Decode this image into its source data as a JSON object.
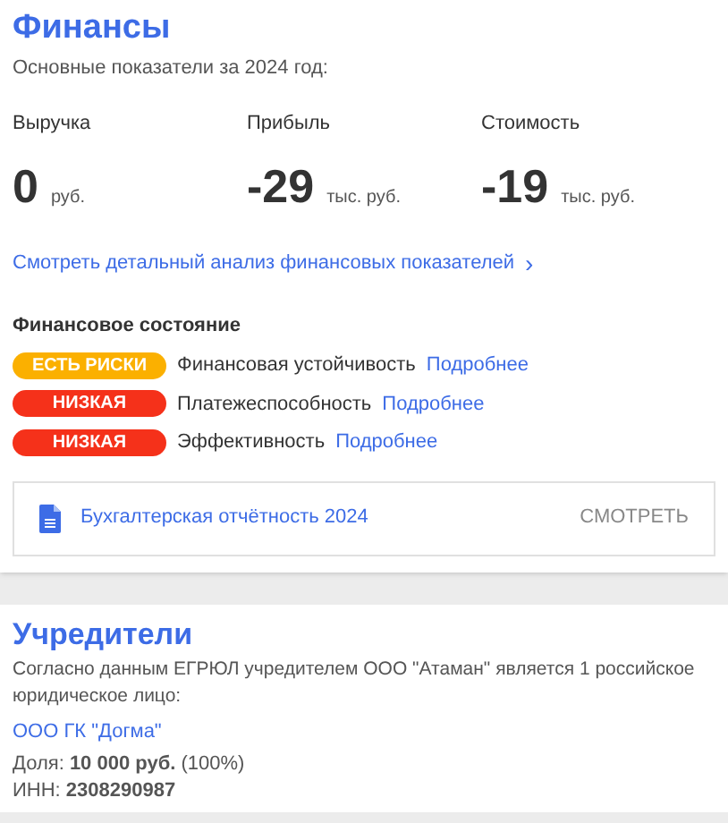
{
  "finance": {
    "title": "Финансы",
    "subtitle": "Основные показатели за 2024 год:",
    "metrics": [
      {
        "label": "Выручка",
        "value": "0",
        "unit": "руб."
      },
      {
        "label": "Прибыль",
        "value": "-29",
        "unit": "тыс. руб."
      },
      {
        "label": "Стоимость",
        "value": "-19",
        "unit": "тыс. руб."
      }
    ],
    "analysis_link": "Смотреть детальный анализ финансовых показателей",
    "analysis_chevron": "›",
    "state_title": "Финансовое состояние",
    "states": [
      {
        "badge": "ЕСТЬ РИСКИ",
        "color": "#fbb000",
        "label": "Финансовая устойчивость",
        "link": "Подробнее"
      },
      {
        "badge": "НИЗКАЯ",
        "color": "#f5311a",
        "label": "Платежеспособность",
        "link": "Подробнее"
      },
      {
        "badge": "НИЗКАЯ",
        "color": "#f5311a",
        "label": "Эффективность",
        "link": "Подробнее"
      }
    ],
    "report": {
      "title": "Бухгалтерская отчётность 2024",
      "action": "СМОТРЕТЬ"
    }
  },
  "founders": {
    "title": "Учредители",
    "description": "Согласно данным ЕГРЮЛ учредителем ООО \"Атаман\" является 1 российское юридическое лицо:",
    "name": "ООО ГК \"Догма\"",
    "share": "Доля: **10 000 руб.** (100%)",
    "inn": "ИНН: **2308290987**"
  }
}
